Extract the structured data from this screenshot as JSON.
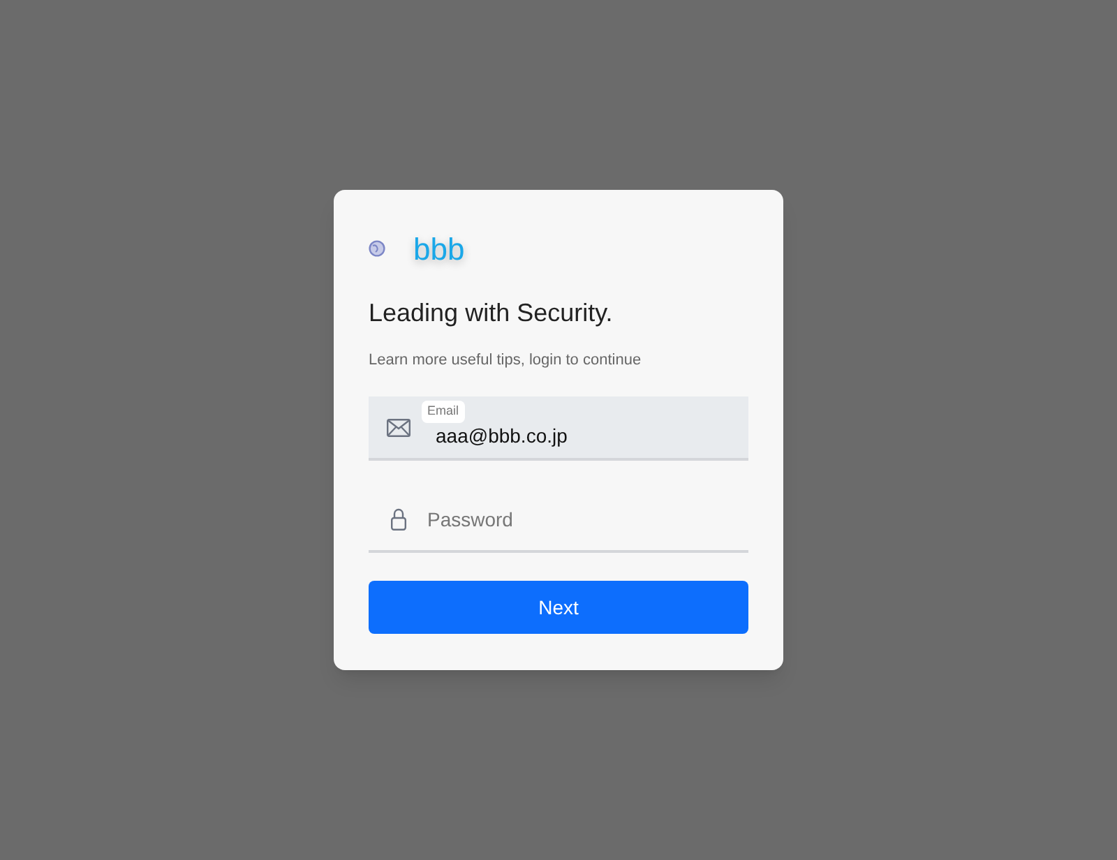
{
  "brand": {
    "name": "bbb"
  },
  "heading": "Leading with Security.",
  "subtitle": "Learn more useful tips, login to continue",
  "fields": [
    {
      "kind": "email",
      "label": "Email",
      "value": "aaa@bbb.co.jp",
      "focused": true
    },
    {
      "kind": "password",
      "placeholder": "Password",
      "focused": false
    }
  ],
  "button": {
    "label": "Next"
  }
}
